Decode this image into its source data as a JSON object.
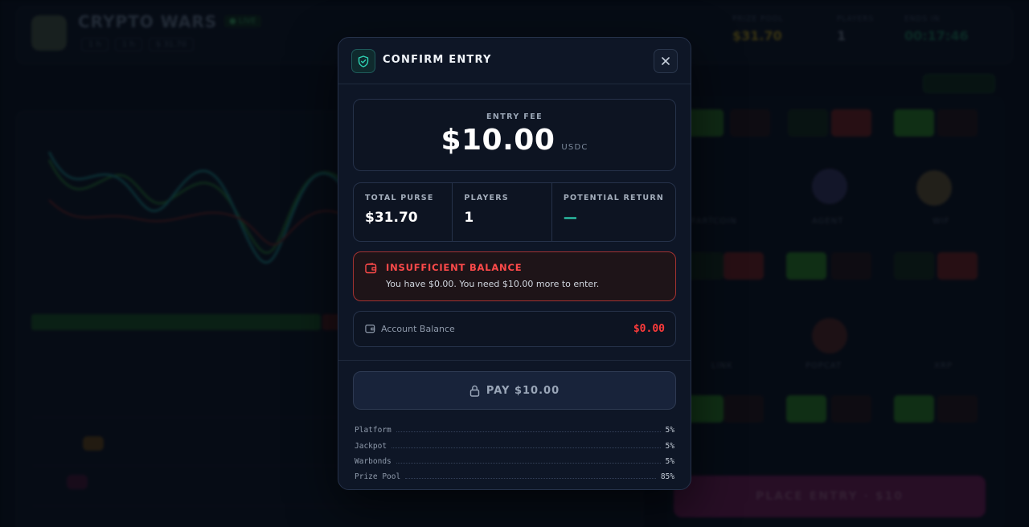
{
  "background": {
    "app_title": "CRYPTO WARS",
    "live_badge": "● LIVE",
    "chips": [
      "1 h",
      "1 h",
      "$ 31.70"
    ],
    "stats": [
      {
        "label": "PRIZE POOL",
        "value": "$31.70",
        "color": "#b59a1e"
      },
      {
        "label": "PLAYERS",
        "value": "1",
        "color": "#7b8799"
      },
      {
        "label": "ENDS IN",
        "value": "00:17:46",
        "color": "#1f7a5a"
      }
    ],
    "place_entry_label": "PLACE ENTRY · $10",
    "card_labels": [
      "FARTCOIN",
      "AGENT",
      "WIF",
      "LINK",
      "POPCAT",
      "XRP"
    ]
  },
  "modal": {
    "title": "CONFIRM ENTRY",
    "entry_fee": {
      "label": "ENTRY FEE",
      "amount": "$10.00",
      "unit": "USDC"
    },
    "stats": [
      {
        "label": "TOTAL PURSE",
        "value": "$31.70"
      },
      {
        "label": "PLAYERS",
        "value": "1"
      },
      {
        "label": "POTENTIAL RETURN",
        "value": "—"
      }
    ],
    "alert": {
      "title": "INSUFFICIENT BALANCE",
      "message": "You have $0.00. You need $10.00 more to enter."
    },
    "balance": {
      "label": "Account Balance",
      "value": "$0.00"
    },
    "pay_button": {
      "label": "PAY $10.00"
    },
    "breakdown": [
      {
        "label": "Platform",
        "value": "5%"
      },
      {
        "label": "Jackpot",
        "value": "5%"
      },
      {
        "label": "Warbonds",
        "value": "5%"
      },
      {
        "label": "Prize Pool",
        "value": "85%"
      }
    ]
  },
  "colors": {
    "accent_teal": "#2fd3b4",
    "danger": "#ff3b3b",
    "modal_bg": "#0e1626"
  },
  "icons": {
    "header": "shield-check-icon",
    "close": "close-icon",
    "alert": "wallet-icon",
    "balance": "wallet-icon",
    "pay": "lock-icon"
  }
}
